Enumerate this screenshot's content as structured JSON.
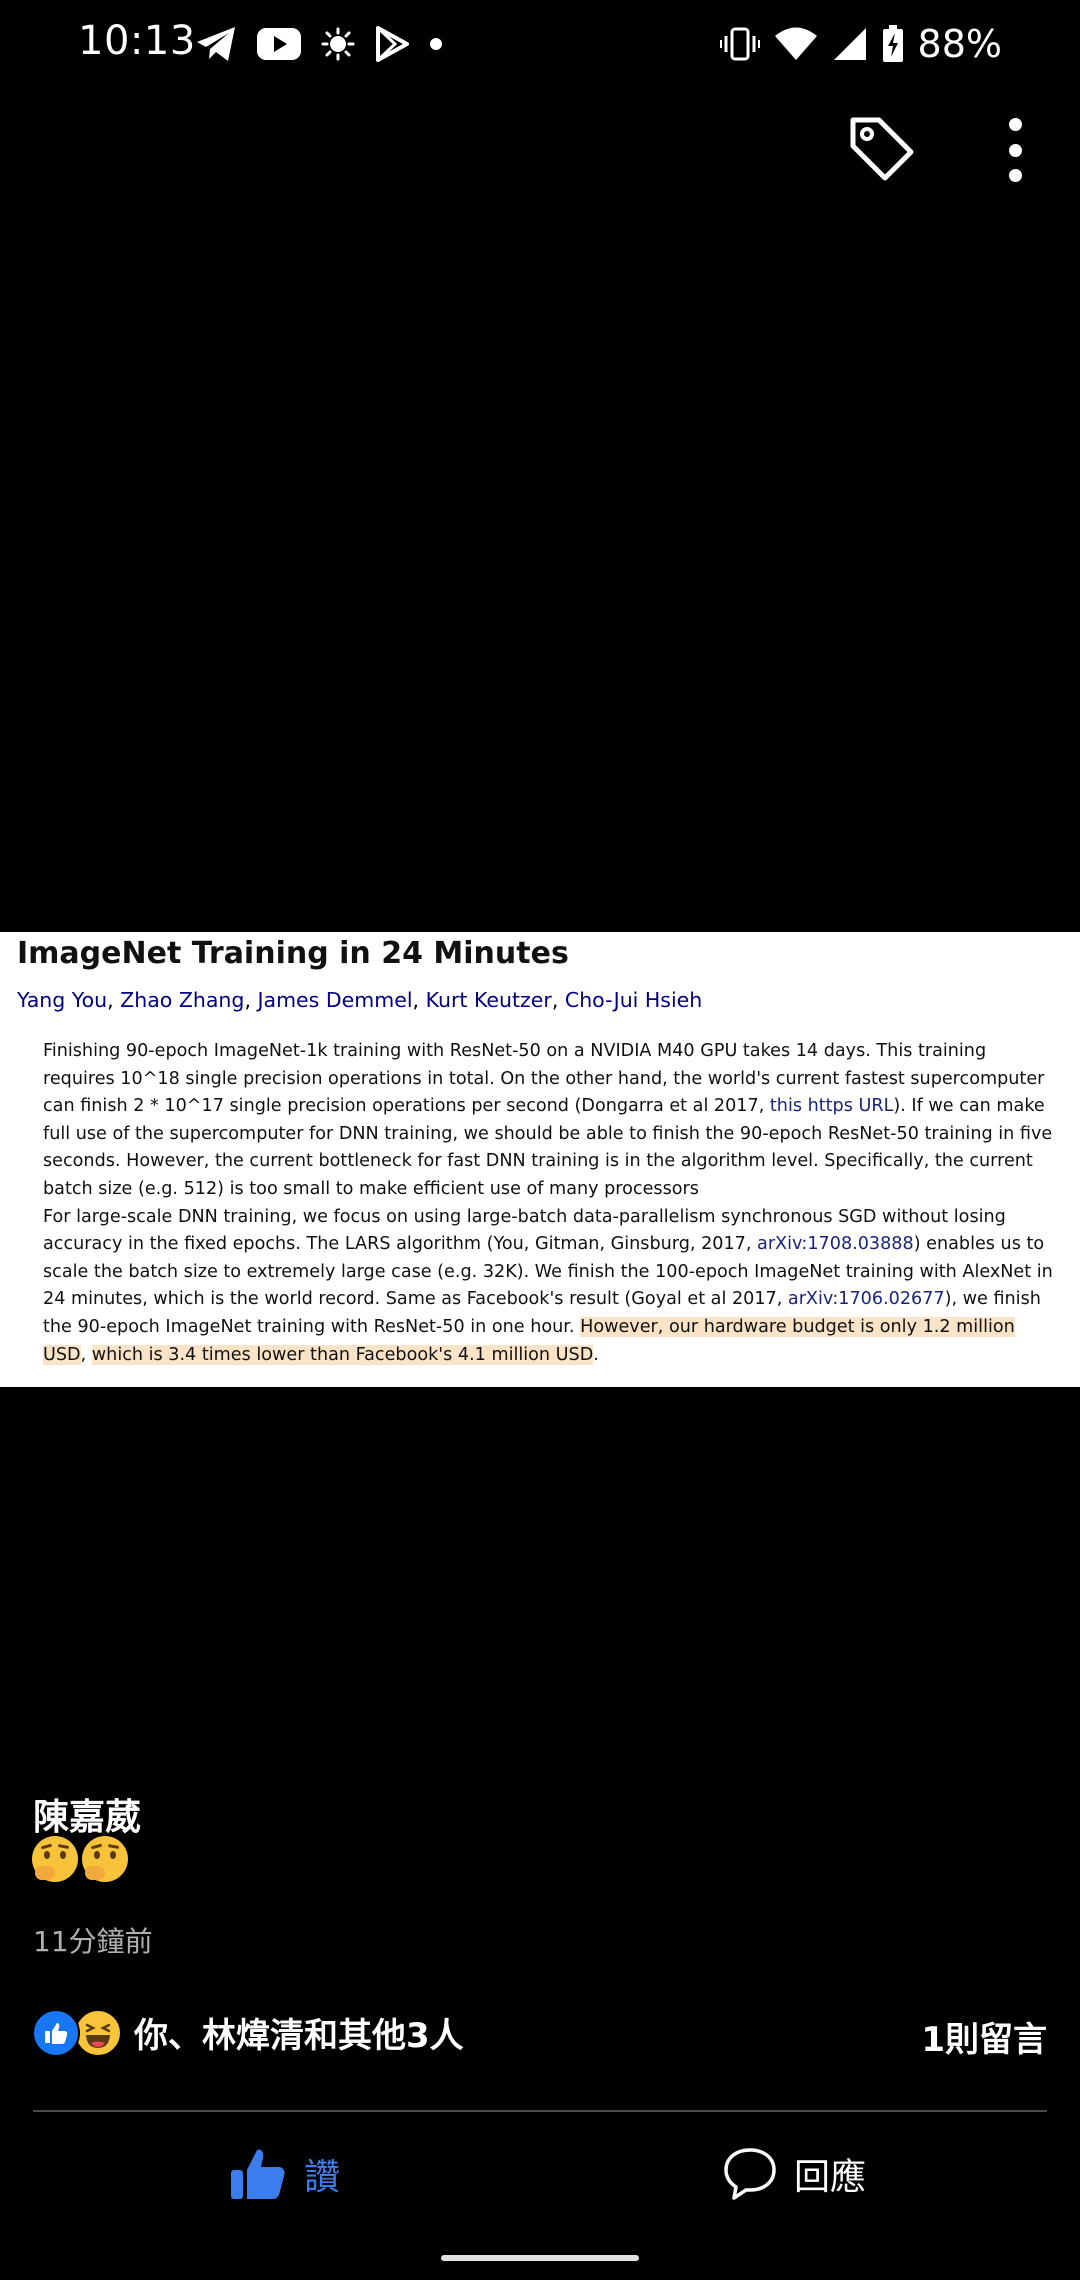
{
  "status_bar": {
    "time": "10:13",
    "battery": "88%",
    "icons_left": [
      "telegram-icon",
      "youtube-icon",
      "brightness-icon",
      "play-store-icon",
      "dot-icon"
    ],
    "icons_right": [
      "vibrate-icon",
      "wifi-icon",
      "signal-icon",
      "battery-charging-icon"
    ]
  },
  "toolbar": {
    "icons": [
      "tag-icon",
      "more-vert-icon"
    ]
  },
  "paper": {
    "title": "ImageNet Training in 24 Minutes",
    "authors": [
      "Yang You",
      "Zhao Zhang",
      "James Demmel",
      "Kurt Keutzer",
      "Cho-Jui Hsieh"
    ],
    "author_sep": ", ",
    "abstract": {
      "p1": "Finishing 90-epoch ImageNet-1k training with ResNet-50 on a NVIDIA M40 GPU takes 14 days. This training requires 10^18 single precision operations in total. On the other hand, the world's current fastest supercomputer can finish 2 * 10^17 single precision operations per second (Dongarra et al 2017, ",
      "p1_link": "this https URL",
      "p1_rest": "). If we can make full use of the supercomputer for DNN training, we should be able to finish the 90-epoch ResNet-50 training in five seconds. However, the current bottleneck for fast DNN training is in the algorithm level. Specifically, the current batch size (e.g. 512) is too small to make efficient use of many processors",
      "p2_a": "For large-scale DNN training, we focus on using large-batch data-parallelism synchronous SGD without losing accuracy in the fixed epochs. The LARS algorithm (You, Gitman, Ginsburg, 2017, ",
      "p2_link1": "arXiv:1708.03888",
      "p2_b": ") enables us to scale the batch size to extremely large case (e.g. 32K). We finish the 100-epoch ImageNet training with AlexNet in 24 minutes, which is the world record. Same as Facebook's result (Goyal et al 2017, ",
      "p2_link2": "arXiv:1706.02677",
      "p2_c": "), we finish the 90-epoch ImageNet training with ResNet-50 in one hour. ",
      "p2_hl1": "However, our hardware budget is only 1.2 million USD",
      "p2_comma": ", ",
      "p2_hl2": "which is 3.4 times lower than Facebook's 4.1 million USD",
      "p2_end": "."
    }
  },
  "post": {
    "author": "陳嘉葳",
    "emojis": [
      "thinking-face-icon",
      "thinking-face-icon"
    ],
    "timestamp": "11分鐘前"
  },
  "reactions": {
    "icons": [
      "like-reaction-icon",
      "haha-reaction-icon"
    ],
    "text": "你、林煒清和其他3人",
    "comment_count": "1則留言"
  },
  "actions": {
    "like_label": "讚",
    "comment_label": "回應"
  },
  "colors": {
    "like_blue": "#3b7ded",
    "highlight": "#fbe3c7",
    "link": "#1a237e"
  }
}
